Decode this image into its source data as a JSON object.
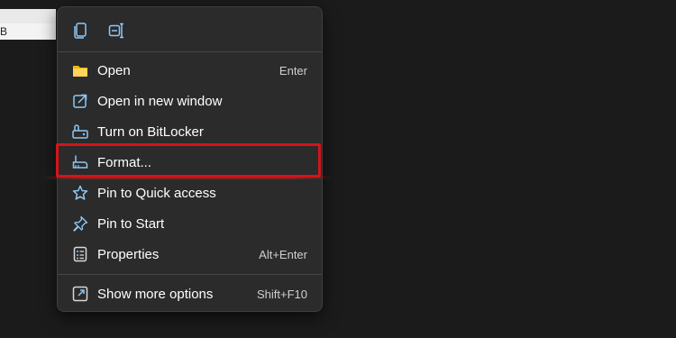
{
  "background": {
    "partial_row_text": "B"
  },
  "top_actions": [
    {
      "icon": "copy-icon"
    },
    {
      "icon": "rename-icon"
    }
  ],
  "menu_items": [
    {
      "label": "Open",
      "shortcut": "Enter",
      "icon": "folder-icon"
    },
    {
      "label": "Open in new window",
      "shortcut": "",
      "icon": "open-new-window-icon"
    },
    {
      "label": "Turn on BitLocker",
      "shortcut": "",
      "icon": "bitlocker-icon"
    },
    {
      "label": "Format...",
      "shortcut": "",
      "icon": "format-icon",
      "highlighted": true
    },
    {
      "label": "Pin to Quick access",
      "shortcut": "",
      "icon": "star-icon"
    },
    {
      "label": "Pin to Start",
      "shortcut": "",
      "icon": "pin-icon"
    },
    {
      "label": "Properties",
      "shortcut": "Alt+Enter",
      "icon": "properties-icon"
    },
    {
      "label": "Show more options",
      "shortcut": "Shift+F10",
      "icon": "more-options-icon"
    }
  ],
  "colors": {
    "menu_background": "#2b2b2b",
    "highlight_border": "#d4141a",
    "accent_icon": "#8ec8f5"
  }
}
